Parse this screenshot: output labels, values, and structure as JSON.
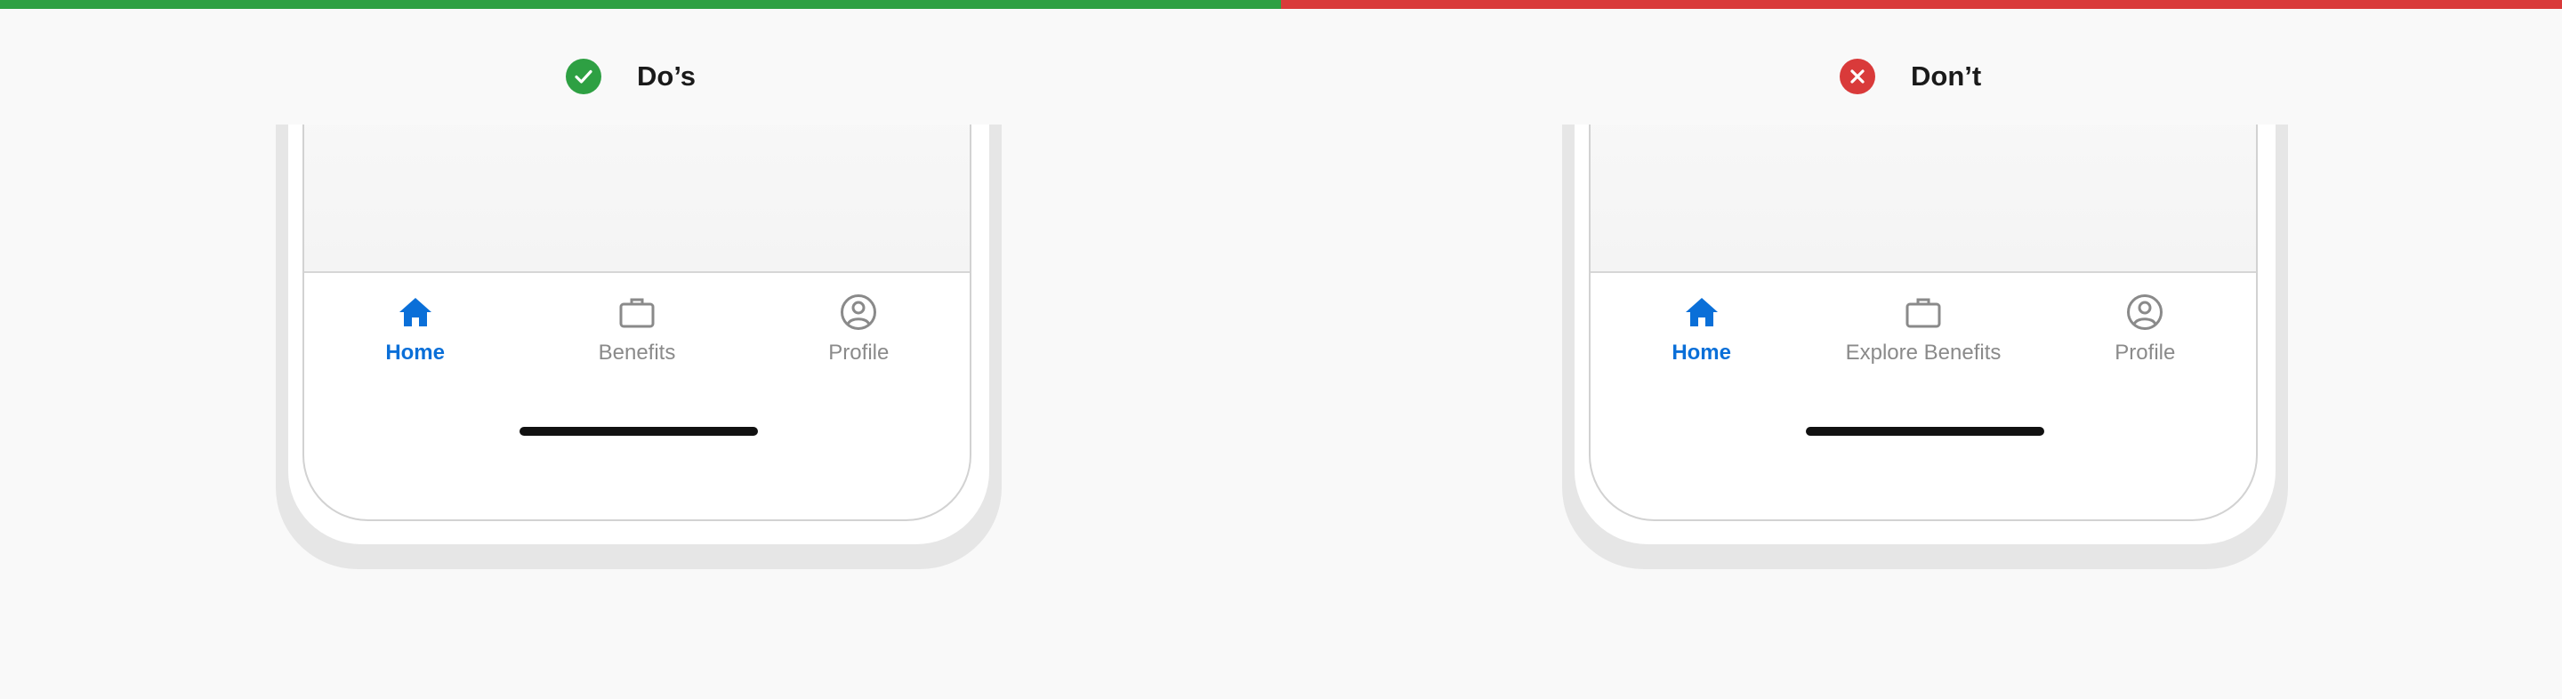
{
  "colors": {
    "do": "#2ea043",
    "dont": "#d93a3a",
    "active_tab": "#0a6fd8",
    "inactive_tab": "#8a8a8a"
  },
  "do_example": {
    "heading": "Do’s",
    "status_icon": "checkmark-icon",
    "tabs": [
      {
        "label": "Home",
        "icon": "home-icon",
        "active": true
      },
      {
        "label": "Benefits",
        "icon": "briefcase-icon",
        "active": false
      },
      {
        "label": "Profile",
        "icon": "profile-icon",
        "active": false
      }
    ]
  },
  "dont_example": {
    "heading": "Don’t",
    "status_icon": "cross-icon",
    "tabs": [
      {
        "label": "Home",
        "icon": "home-icon",
        "active": true
      },
      {
        "label": "Explore Benefits",
        "icon": "briefcase-icon",
        "active": false
      },
      {
        "label": "Profile",
        "icon": "profile-icon",
        "active": false
      }
    ]
  }
}
